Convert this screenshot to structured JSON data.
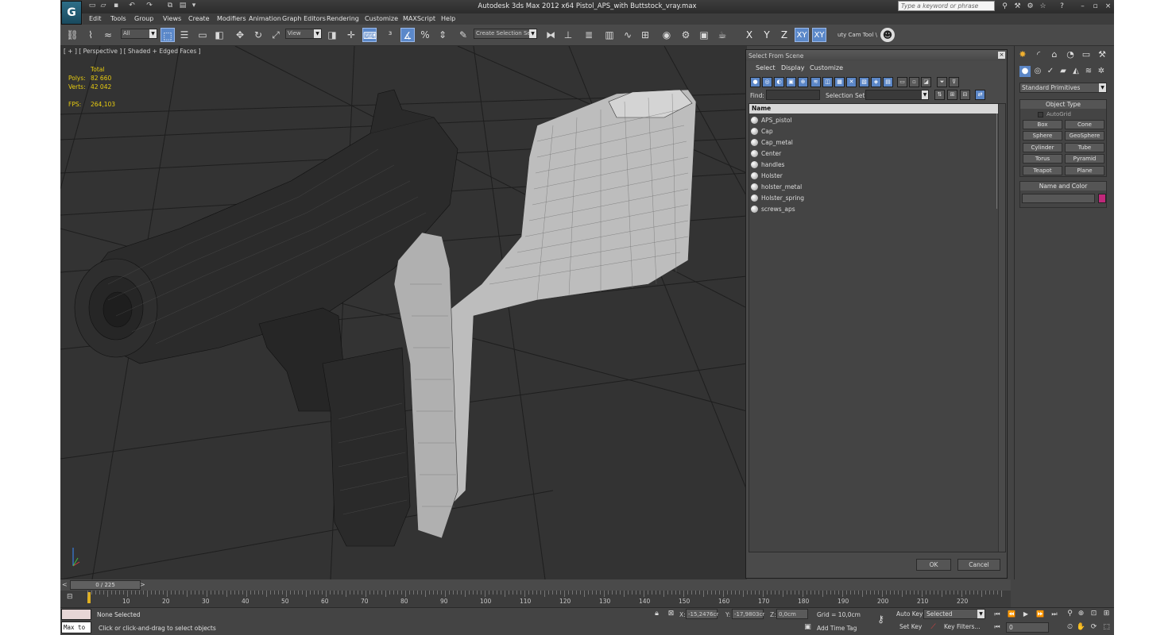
{
  "title": {
    "text": "Autodesk 3ds Max  2012 x64      Pistol_APS_with Buttstock_vray.max",
    "search_placeholder": "Type a keyword or phrase",
    "logo_letter": "G"
  },
  "menu": [
    "Edit",
    "Tools",
    "Group",
    "Views",
    "Create",
    "Modifiers",
    "Animation",
    "Graph Editors",
    "Rendering",
    "Customize",
    "MAXScript",
    "Help"
  ],
  "toolbar": {
    "filter_value": "All",
    "ref_coord_value": "View",
    "selection_set_placeholder": "Create Selection Se",
    "axes": [
      "X",
      "Y",
      "Z",
      "XY",
      "XY"
    ],
    "cam_tool": "uty Cam Tool \\"
  },
  "viewport": {
    "label": "[ + ] [ Perspective ] [ Shaded + Edged Faces ]",
    "stats_header": "Total",
    "polys_label": "Polys:",
    "polys_value": "82 660",
    "verts_label": "Verts:",
    "verts_value": "42 042",
    "fps_label": "FPS:",
    "fps_value": "264,103"
  },
  "dialog": {
    "title": "Select From Scene",
    "menu": [
      "Select",
      "Display",
      "Customize"
    ],
    "find_label": "Find:",
    "selection_set_label": "Selection Set:",
    "column_name": "Name",
    "items": [
      "APS_pistol",
      "Cap",
      "Cap_metal",
      "Center",
      "handles",
      "Holster",
      "holster_metal",
      "Holster_spring",
      "screws_aps"
    ],
    "ok_label": "OK",
    "cancel_label": "Cancel"
  },
  "command_panel": {
    "dropdown_value": "Standard Primitives",
    "object_type_title": "Object Type",
    "autogrid_label": "AutoGrid",
    "buttons": [
      "Box",
      "Cone",
      "Sphere",
      "GeoSphere",
      "Cylinder",
      "Tube",
      "Torus",
      "Pyramid",
      "Teapot",
      "Plane"
    ],
    "name_color_title": "Name and Color",
    "color": "#c0287a"
  },
  "timeline": {
    "frame_label": "0 / 225",
    "prev": "<",
    "next": ">",
    "ticks": [
      "10",
      "20",
      "30",
      "40",
      "50",
      "60",
      "70",
      "80",
      "90",
      "100",
      "110",
      "120",
      "130",
      "140",
      "150",
      "160",
      "170",
      "180",
      "190",
      "200",
      "210",
      "220"
    ]
  },
  "status": {
    "maxscript_text": "Max to",
    "selection_msg": "None Selected",
    "prompt_msg": "Click or click-and-drag to select objects",
    "x_label": "X:",
    "x_value": "-15,2476cr",
    "y_label": "Y:",
    "y_value": "-17,9803cr",
    "z_label": "Z:",
    "z_value": "0,0cm",
    "grid": "Grid = 10,0cm",
    "add_time_tag": "Add Time Tag",
    "auto_key": "Auto Key",
    "set_key": "Set Key",
    "selected_value": "Selected",
    "key_filters": "Key Filters...",
    "frame_value": "0"
  }
}
